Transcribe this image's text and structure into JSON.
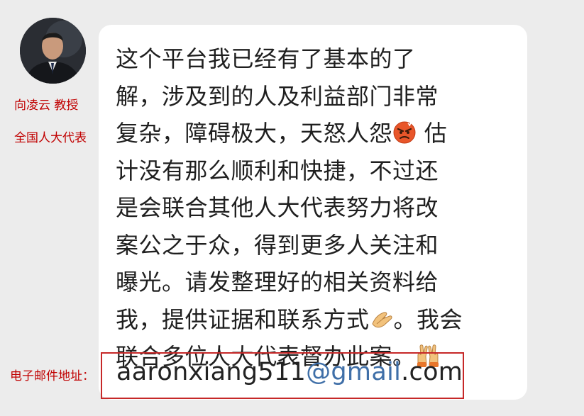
{
  "sender": {
    "name_title": "向凌云  教授",
    "position": "全国人大代表",
    "avatar_icon": "person-portrait-icon"
  },
  "message": {
    "lines": [
      [
        "这个平台我已经有了基本的了"
      ],
      [
        "解，涉及到的人及利益部门非常"
      ],
      [
        "复杂，障碍极大，天怒人怨",
        "angry-face-emoji",
        " 估"
      ],
      [
        "计没有那么顺利和快捷，不过还"
      ],
      [
        "是会联合其他人大代表努力将改"
      ],
      [
        "案公之于众，得到更多人关注和"
      ],
      [
        "曝光。请发整理好的相关资料给"
      ],
      [
        "我，提供证据和联系方式",
        "folded-hands-emoji",
        "。我会"
      ],
      [
        "联合多位人大代表督办此案。",
        "victory-hands-emoji"
      ]
    ],
    "line_1": "这个平台我已经有了基本的了",
    "line_2": "解，涉及到的人及利益部门非常",
    "line_3a": "复杂，障碍极大，天怒人怨",
    "line_3b": " 估",
    "line_4": "计没有那么顺利和快捷，不过还",
    "line_5": "是会联合其他人大代表努力将改",
    "line_6": "案公之于众，得到更多人关注和",
    "line_7": "曝光。请发整理好的相关资料给",
    "line_8a": "我，提供证据和联系方式",
    "line_8b": "。我会",
    "line_9": "联合多位人大代表督办此案。"
  },
  "email": {
    "label": "电子邮件地址：",
    "user": "aaronxiang511",
    "at_domain": "@gmail",
    "tld": ".com"
  },
  "colors": {
    "label_red": "#c00000",
    "box_border": "#c62828",
    "link_blue": "#3f6fa8",
    "background": "#ececec",
    "bubble": "#ffffff"
  }
}
